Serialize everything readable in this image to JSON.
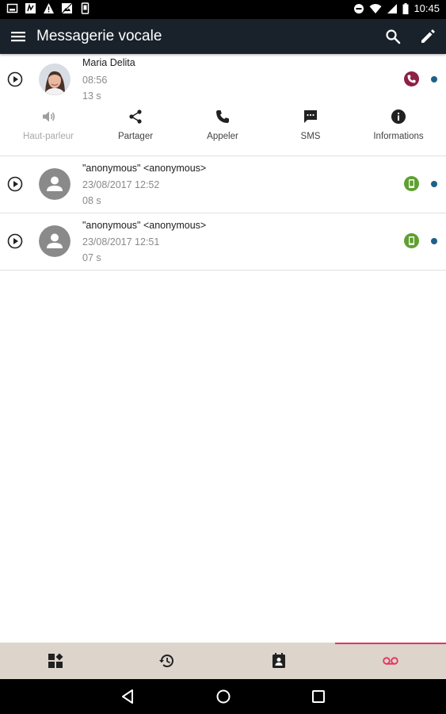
{
  "status_bar": {
    "time": "10:45",
    "notification_icons": [
      "image-notification-icon",
      "app-notification-icon",
      "warning-icon",
      "photo-notification-icon",
      "phone-notification-icon"
    ],
    "system_icons": [
      "do-not-disturb-icon",
      "wifi-icon",
      "signal-icon",
      "battery-icon"
    ]
  },
  "app_bar": {
    "title": "Messagerie vocale",
    "background": "#19212a"
  },
  "voicemails": [
    {
      "name": "Maria Delita",
      "time": "08:56",
      "duration": "13 s",
      "avatar": "photo",
      "type_icon": "phone-icon",
      "type_color": "#8e1f45",
      "unread": true,
      "expanded": true,
      "actions": [
        {
          "label": "Haut-parleur",
          "icon": "speaker-icon",
          "enabled": false
        },
        {
          "label": "Partager",
          "icon": "share-icon",
          "enabled": true
        },
        {
          "label": "Appeler",
          "icon": "call-icon",
          "enabled": true
        },
        {
          "label": "SMS",
          "icon": "sms-icon",
          "enabled": true
        },
        {
          "label": "Informations",
          "icon": "info-icon",
          "enabled": true
        }
      ]
    },
    {
      "name": "\"anonymous\" <anonymous>",
      "time": "23/08/2017 12:52",
      "duration": "08 s",
      "avatar": "default",
      "type_icon": "mobile-icon",
      "type_color": "#5fa030",
      "unread": true,
      "expanded": false
    },
    {
      "name": "\"anonymous\" <anonymous>",
      "time": "23/08/2017 12:51",
      "duration": "07 s",
      "avatar": "default",
      "type_icon": "mobile-icon",
      "type_color": "#5fa030",
      "unread": true,
      "expanded": false
    }
  ],
  "colors": {
    "unread_dot": "#1f5f8b",
    "accent": "#e8315b",
    "tab_bar": "#ddd4cc"
  },
  "tabs": [
    {
      "icon": "dashboard-icon",
      "active": false
    },
    {
      "icon": "history-icon",
      "active": false
    },
    {
      "icon": "contacts-icon",
      "active": false
    },
    {
      "icon": "voicemail-icon",
      "active": true
    }
  ],
  "nav_bar": [
    "back-icon",
    "home-icon",
    "recents-icon"
  ]
}
